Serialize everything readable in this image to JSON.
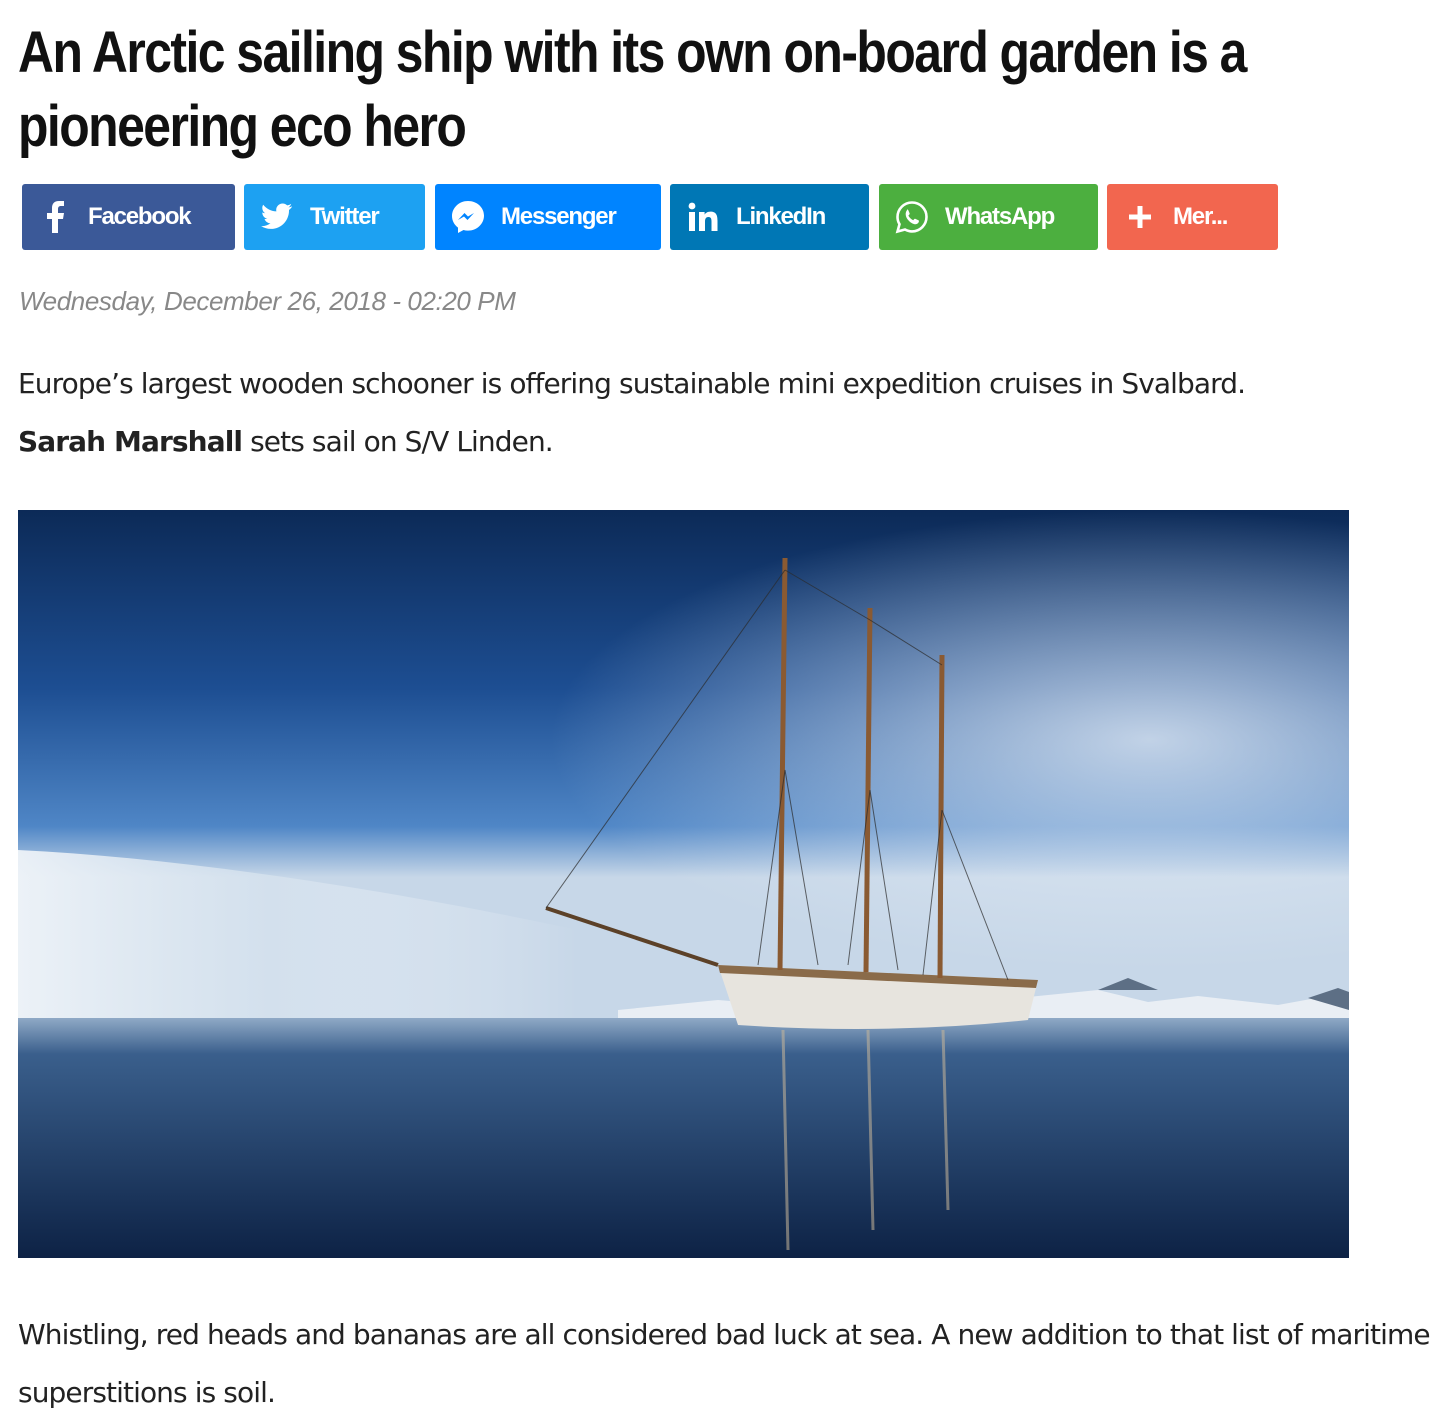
{
  "article": {
    "title": "An Arctic sailing ship with its own on-board garden is a pioneering eco hero",
    "date": "Wednesday, December 26, 2018 - 02:20 PM",
    "intro": "Europe’s largest wooden schooner is offering sustainable mini expedition cruises in Svalbard.",
    "author": "Sarah Marshall",
    "author_suffix": " sets sail on S/V Linden.",
    "body_paragraph": "Whistling, red heads and bananas are all considered bad luck at sea. A new addition to that list of maritime superstitions is soil."
  },
  "share": {
    "facebook": {
      "label": "Facebook",
      "icon": "facebook-icon",
      "color": "#3b5998"
    },
    "twitter": {
      "label": "Twitter",
      "icon": "twitter-icon",
      "color": "#1da1f2"
    },
    "messenger": {
      "label": "Messenger",
      "icon": "messenger-icon",
      "color": "#0084ff"
    },
    "linkedin": {
      "label": "LinkedIn",
      "icon": "linkedin-icon",
      "color": "#0077b5"
    },
    "whatsapp": {
      "label": "WhatsApp",
      "icon": "whatsapp-icon",
      "color": "#4caf3f"
    },
    "more": {
      "label": "Mer...",
      "icon": "plus-icon",
      "color": "#f2664f"
    }
  },
  "hero_image": {
    "subject": "three-masted wooden schooner on calm arctic water under blue sky"
  }
}
